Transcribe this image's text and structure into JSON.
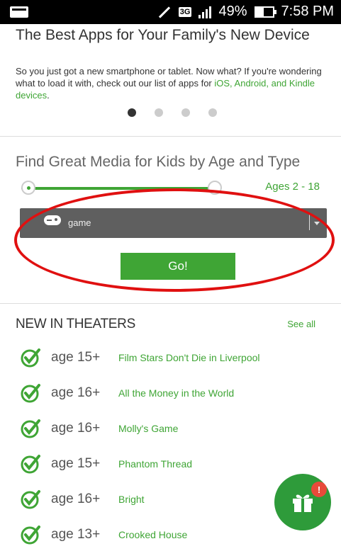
{
  "status_bar": {
    "network": "3G",
    "battery": "49%",
    "time": "7:58 PM"
  },
  "promo": {
    "title": "The Best Apps for Your Family's New Device",
    "text_plain": "So you just got a new smartphone or tablet. Now what? If you're wondering what to load it with, check out our list of apps for ",
    "text_link": "iOS, Android, and Kindle devices",
    "text_end": ".",
    "carousel_active_index": 0,
    "carousel_count": 4
  },
  "finder": {
    "title": "Find Great Media for Kids by Age and Type",
    "age_range_label": "Ages 2 - 18",
    "media_type_value": "game",
    "go_label": "Go!"
  },
  "theaters": {
    "title": "NEW IN THEATERS",
    "see_all": "See all",
    "movies": [
      {
        "age": "age 15+",
        "title": "Film Stars Don't Die in Liverpool"
      },
      {
        "age": "age 16+",
        "title": "All the Money in the World"
      },
      {
        "age": "age 16+",
        "title": "Molly's Game"
      },
      {
        "age": "age 15+",
        "title": "Phantom Thread"
      },
      {
        "age": "age 16+",
        "title": "Bright"
      },
      {
        "age": "age 13+",
        "title": "Crooked House"
      }
    ]
  },
  "gift_badge": "!",
  "colors": {
    "accent_green": "#3fa535",
    "highlight_red": "#e01010",
    "select_bg": "#5f5f5f"
  }
}
